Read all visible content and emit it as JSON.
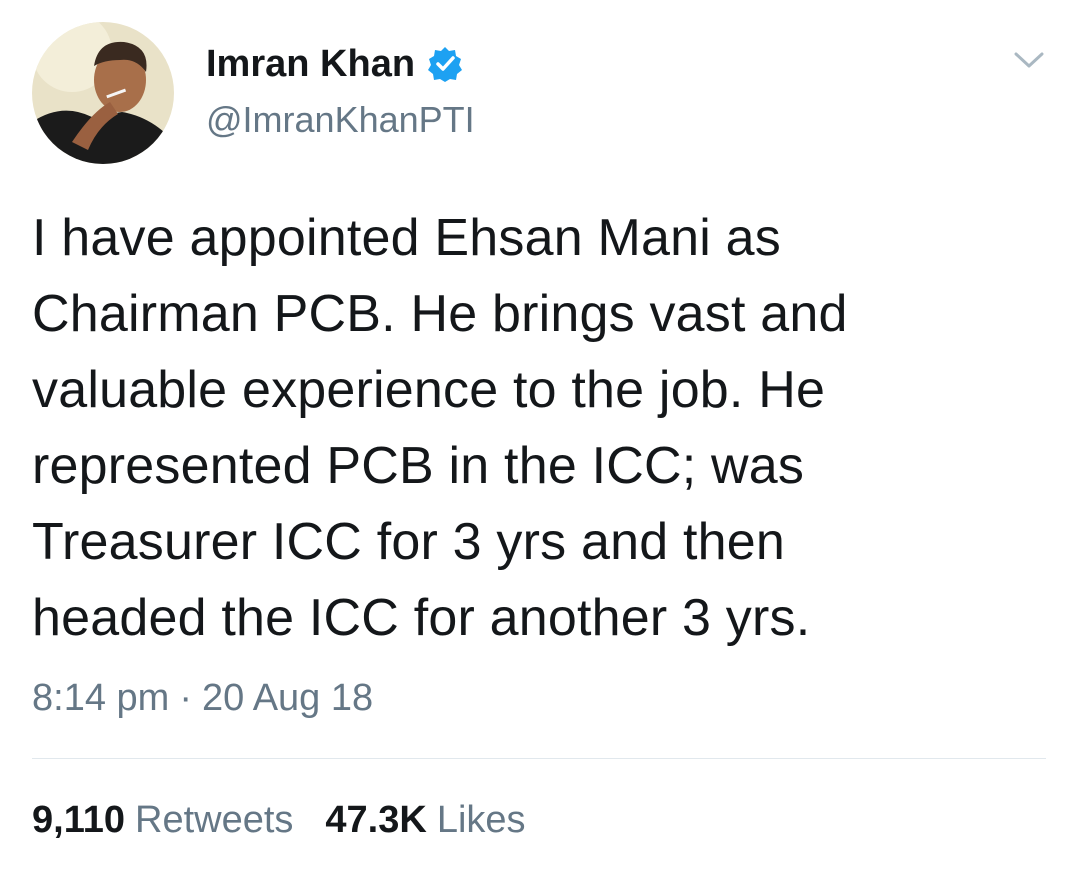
{
  "author": {
    "display_name": "Imran Khan",
    "handle": "@ImranKhanPTI",
    "verified": true,
    "avatar_icon": "profile-photo"
  },
  "tweet": {
    "lines": [
      "I have appointed Ehsan Mani as",
      "Chairman PCB. He brings vast and",
      "valuable experience to the job. He",
      "represented PCB in the ICC; was",
      "Treasurer ICC for 3 yrs and then",
      "headed the ICC for another 3 yrs."
    ],
    "time": "8:14 pm",
    "separator": "·",
    "date": "20 Aug 18"
  },
  "stats": {
    "retweets_count": "9,110",
    "retweets_label": "Retweets",
    "likes_count": "47.3K",
    "likes_label": "Likes"
  },
  "colors": {
    "text_primary": "#14171a",
    "text_secondary": "#657786",
    "verified_blue": "#1da1f2",
    "divider": "#e1e8ed"
  },
  "icons": {
    "verified": "verified-badge-icon",
    "menu": "chevron-down-icon"
  }
}
